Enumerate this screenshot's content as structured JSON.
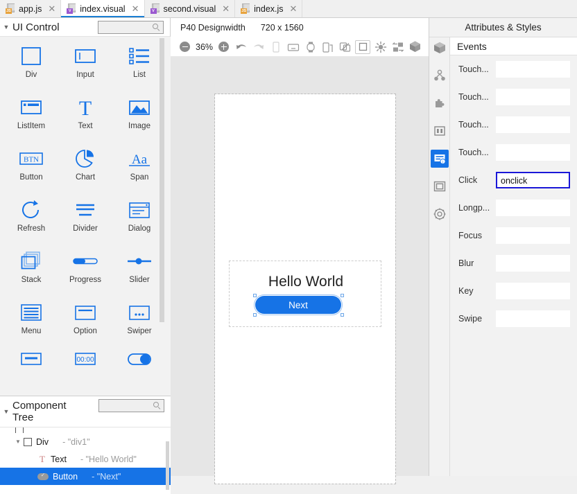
{
  "tabs": [
    {
      "label": "app.js",
      "icon": "js-file-icon",
      "type": "js",
      "active": false
    },
    {
      "label": "index.visual",
      "icon": "visual-file-icon",
      "type": "visual",
      "active": true
    },
    {
      "label": "second.visual",
      "icon": "visual-file-icon",
      "type": "visual",
      "active": false
    },
    {
      "label": "index.js",
      "icon": "js-file-icon",
      "type": "js",
      "active": false
    }
  ],
  "tab_close_glyph": "✕",
  "left_panel": {
    "ui_control": {
      "title": "UI Control",
      "caret": "▼",
      "search_placeholder": "",
      "search_value": "",
      "search_icon": "search-icon"
    },
    "palette_items": [
      {
        "label": "Div",
        "icon": "div-icon"
      },
      {
        "label": "Input",
        "icon": "input-icon"
      },
      {
        "label": "List",
        "icon": "list-icon"
      },
      {
        "label": "ListItem",
        "icon": "listitem-icon"
      },
      {
        "label": "Text",
        "icon": "text-icon"
      },
      {
        "label": "Image",
        "icon": "image-icon"
      },
      {
        "label": "Button",
        "icon": "button-icon"
      },
      {
        "label": "Chart",
        "icon": "chart-icon"
      },
      {
        "label": "Span",
        "icon": "span-icon"
      },
      {
        "label": "Refresh",
        "icon": "refresh-icon"
      },
      {
        "label": "Divider",
        "icon": "divider-icon"
      },
      {
        "label": "Dialog",
        "icon": "dialog-icon"
      },
      {
        "label": "Stack",
        "icon": "stack-icon"
      },
      {
        "label": "Progress",
        "icon": "progress-icon"
      },
      {
        "label": "Slider",
        "icon": "slider-icon"
      },
      {
        "label": "Menu",
        "icon": "menu-icon"
      },
      {
        "label": "Option",
        "icon": "option-icon"
      },
      {
        "label": "Swiper",
        "icon": "swiper-icon"
      },
      {
        "label": "",
        "icon": "toolbar-icon"
      },
      {
        "label": "",
        "icon": "picker-icon"
      },
      {
        "label": "",
        "icon": "switch-icon"
      }
    ],
    "component_tree": {
      "title": "Component Tree",
      "caret": "▼",
      "search_placeholder": "",
      "search_value": "",
      "search_icon": "search-icon",
      "rows": [
        {
          "caret": "▼",
          "icon": "div-node-icon",
          "type": "Div",
          "value": "- \"div1\"",
          "indent": 1,
          "selected": false
        },
        {
          "caret": "",
          "icon": "text-node-icon",
          "type": "Text",
          "value": "- \"Hello World\"",
          "indent": 2,
          "selected": false
        },
        {
          "caret": "",
          "icon": "button-node-icon",
          "type": "Button",
          "value": "- \"Next\"",
          "indent": 2,
          "selected": true
        }
      ]
    }
  },
  "center": {
    "device_name": "P40 Designwidth",
    "device_resolution": "720 x 1560",
    "zoom_level": "36%",
    "toolbar": [
      {
        "icon": "zoom-out-icon",
        "name": "zoom-out-button"
      },
      {
        "icon": "zoom-in-icon",
        "name": "zoom-in-button"
      },
      {
        "icon": "undo-icon",
        "name": "undo-button"
      },
      {
        "icon": "redo-icon",
        "name": "redo-button"
      },
      {
        "icon": "phone-icon",
        "name": "phone-preview-button"
      },
      {
        "icon": "tv-icon",
        "name": "tv-preview-button"
      },
      {
        "icon": "watch-icon",
        "name": "watch-preview-button"
      },
      {
        "icon": "foldable-icon",
        "name": "foldable-preview-button"
      },
      {
        "icon": "rotate-icon",
        "name": "rotate-button"
      },
      {
        "icon": "square-icon",
        "name": "square-preview-button"
      },
      {
        "icon": "brightness-icon",
        "name": "brightness-button"
      },
      {
        "icon": "transfer-icon",
        "name": "transfer-button"
      },
      {
        "icon": "cube-icon",
        "name": "cube-button"
      }
    ],
    "preview": {
      "text_component": "Hello World",
      "button_component": "Next"
    }
  },
  "right_panel": {
    "title": "Attributes & Styles",
    "strip_icons": [
      {
        "icon": "cube-icon",
        "name": "strip-cube",
        "active": false
      },
      {
        "icon": "nodes-icon",
        "name": "strip-nodes",
        "active": false
      },
      {
        "icon": "puzzle-icon",
        "name": "strip-puzzle",
        "active": false
      },
      {
        "icon": "columns-icon",
        "name": "strip-columns",
        "active": false
      },
      {
        "icon": "events-icon",
        "name": "strip-events",
        "active": true
      },
      {
        "icon": "frame-icon",
        "name": "strip-frame",
        "active": false
      },
      {
        "icon": "atom-icon",
        "name": "strip-atom",
        "active": false
      }
    ],
    "section_title": "Events",
    "events": [
      {
        "label": "Touch...",
        "value": "",
        "focused": false
      },
      {
        "label": "Touch...",
        "value": "",
        "focused": false
      },
      {
        "label": "Touch...",
        "value": "",
        "focused": false
      },
      {
        "label": "Touch...",
        "value": "",
        "focused": false
      },
      {
        "label": "Click",
        "value": "onclick",
        "focused": true
      },
      {
        "label": "Longp...",
        "value": "",
        "focused": false
      },
      {
        "label": "Focus",
        "value": "",
        "focused": false
      },
      {
        "label": "Blur",
        "value": "",
        "focused": false
      },
      {
        "label": "Key",
        "value": "",
        "focused": false
      },
      {
        "label": "Swipe",
        "value": "",
        "focused": false
      }
    ]
  },
  "colors": {
    "accent_blue": "#1673e6",
    "focus_border": "#1a17d8",
    "tab_active_underline": "#1a7fd4",
    "js_badge": "#e8a33d",
    "visual_badge": "#9b59d0"
  }
}
